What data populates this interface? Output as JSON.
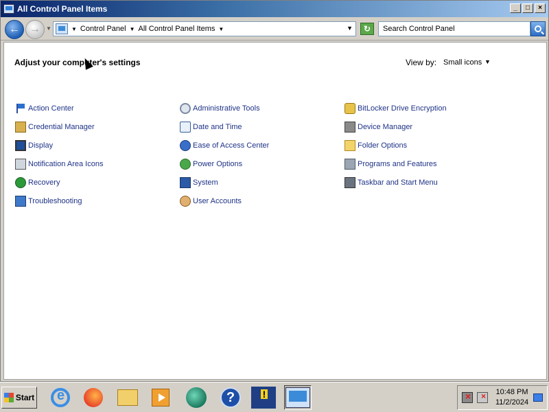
{
  "window": {
    "title": "All Control Panel Items",
    "buttons": {
      "minimize": "_",
      "maximize": "□",
      "close": "×"
    }
  },
  "navbar": {
    "back_glyph": "←",
    "forward_glyph": "→",
    "breadcrumbs": [
      "Control Panel",
      "All Control Panel Items"
    ],
    "search_placeholder": "Search Control Panel",
    "refresh_glyph": "↻"
  },
  "main": {
    "heading": "Adjust your computer's settings",
    "view_by_label": "View by:",
    "view_by_value": "Small icons",
    "columns": [
      [
        {
          "label": "Action Center",
          "icon": "flag-icon"
        },
        {
          "label": "Credential Manager",
          "icon": "safe-icon"
        },
        {
          "label": "Display",
          "icon": "monitor-icon"
        },
        {
          "label": "Notification Area Icons",
          "icon": "notification-icon"
        },
        {
          "label": "Recovery",
          "icon": "recovery-icon"
        },
        {
          "label": "Troubleshooting",
          "icon": "troubleshooting-icon"
        }
      ],
      [
        {
          "label": "Administrative Tools",
          "icon": "gear-icon"
        },
        {
          "label": "Date and Time",
          "icon": "clock-icon"
        },
        {
          "label": "Ease of Access Center",
          "icon": "accessibility-icon"
        },
        {
          "label": "Power Options",
          "icon": "power-icon"
        },
        {
          "label": "System",
          "icon": "system-icon"
        },
        {
          "label": "User Accounts",
          "icon": "users-icon"
        }
      ],
      [
        {
          "label": "BitLocker Drive Encryption",
          "icon": "key-icon"
        },
        {
          "label": "Device Manager",
          "icon": "device-icon"
        },
        {
          "label": "Folder Options",
          "icon": "folder-icon"
        },
        {
          "label": "Programs and Features",
          "icon": "programs-icon"
        },
        {
          "label": "Taskbar and Start Menu",
          "icon": "taskbar-icon"
        }
      ]
    ]
  },
  "taskbar": {
    "start_label": "Start",
    "apps": [
      "internet-explorer-icon",
      "firefox-icon",
      "windows-explorer-icon",
      "media-player-icon",
      "green-app-icon",
      "help-icon",
      "action-center-flag-icon",
      "control-panel-icon"
    ],
    "time": "10:48 PM",
    "date": "11/2/2024"
  },
  "colors": {
    "link": "#1e3287",
    "title_gradient_start": "#0a246a",
    "window_bg": "#d4d0c8"
  }
}
